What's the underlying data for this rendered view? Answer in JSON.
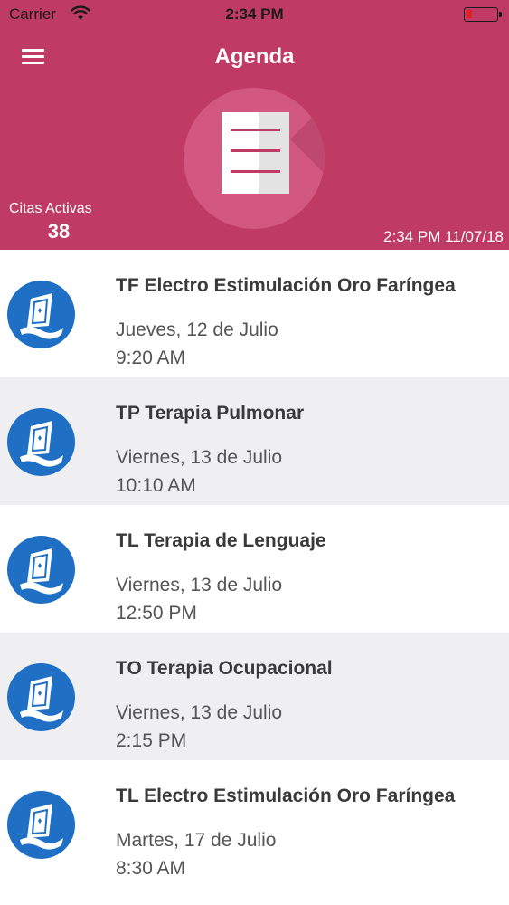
{
  "status_bar": {
    "carrier": "Carrier",
    "time": "2:34 PM",
    "wifi_icon": "wifi-icon",
    "battery_icon": "battery-low-icon"
  },
  "header": {
    "menu_icon": "hamburger-menu-icon",
    "title": "Agenda",
    "logo_icon": "document-icon",
    "citas_label": "Citas Activas",
    "citas_count": "38",
    "timestamp": "2:34 PM 11/07/18",
    "background_color": "#c03a66"
  },
  "appointments": [
    {
      "title": "TF Electro Estimulación Oro Faríngea",
      "date": "Jueves, 12 de Julio",
      "time": "9:20 AM",
      "icon": "sailboat-logo-icon"
    },
    {
      "title": "TP Terapia Pulmonar",
      "date": "Viernes, 13 de Julio",
      "time": "10:10 AM",
      "icon": "sailboat-logo-icon"
    },
    {
      "title": "TL Terapia de Lenguaje",
      "date": "Viernes, 13 de Julio",
      "time": "12:50 PM",
      "icon": "sailboat-logo-icon"
    },
    {
      "title": "TO Terapia Ocupacional",
      "date": "Viernes, 13 de Julio",
      "time": "2:15 PM",
      "icon": "sailboat-logo-icon"
    },
    {
      "title": "TL Electro Estimulación Oro Faríngea",
      "date": "Martes, 17 de Julio",
      "time": "8:30 AM",
      "icon": "sailboat-logo-icon"
    }
  ],
  "colors": {
    "accent": "#c03a66",
    "avatar": "#1f6fc4",
    "row_alt": "#efeff2"
  }
}
